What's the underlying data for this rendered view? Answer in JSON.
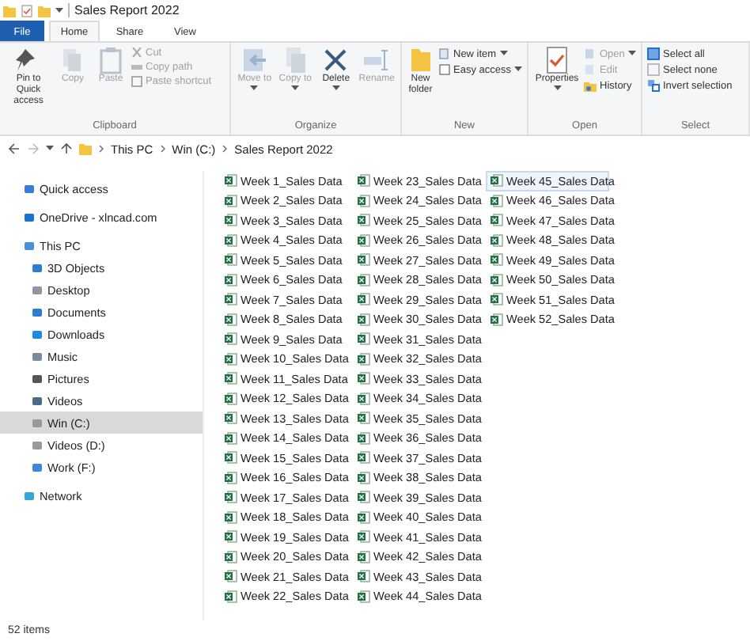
{
  "title_bar": {
    "title": "Sales Report 2022"
  },
  "ribbon_tabs": [
    {
      "label": "File",
      "kind": "file",
      "selected": false
    },
    {
      "label": "Home",
      "kind": "tab",
      "selected": true
    },
    {
      "label": "Share",
      "kind": "tab",
      "selected": false
    },
    {
      "label": "View",
      "kind": "tab",
      "selected": false
    }
  ],
  "ribbon_groups": [
    {
      "label": "Clipboard",
      "buttons": [
        {
          "label": "Pin to Quick access",
          "kind": "large",
          "disabled": false,
          "dropdown": false
        },
        {
          "label": "Copy",
          "kind": "large",
          "disabled": true,
          "dropdown": false
        },
        {
          "label": "Paste",
          "kind": "large",
          "disabled": true,
          "dropdown": false
        },
        {
          "label": "Cut",
          "kind": "small",
          "disabled": true,
          "dropdown": false
        },
        {
          "label": "Copy path",
          "kind": "small",
          "disabled": true,
          "dropdown": false
        },
        {
          "label": "Paste shortcut",
          "kind": "small",
          "disabled": true,
          "dropdown": false
        }
      ]
    },
    {
      "label": "Organize",
      "buttons": [
        {
          "label": "Move to",
          "kind": "large",
          "disabled": true,
          "dropdown": true
        },
        {
          "label": "Copy to",
          "kind": "large",
          "disabled": true,
          "dropdown": true
        },
        {
          "label": "Delete",
          "kind": "large",
          "disabled": false,
          "dropdown": true
        },
        {
          "label": "Rename",
          "kind": "large",
          "disabled": true,
          "dropdown": false
        }
      ]
    },
    {
      "label": "New",
      "buttons": [
        {
          "label": "New folder",
          "kind": "large",
          "disabled": false,
          "dropdown": false
        },
        {
          "label": "New item",
          "kind": "small",
          "disabled": false,
          "dropdown": true
        },
        {
          "label": "Easy access",
          "kind": "small",
          "disabled": false,
          "dropdown": true
        }
      ]
    },
    {
      "label": "Open",
      "buttons": [
        {
          "label": "Properties",
          "kind": "large",
          "disabled": false,
          "dropdown": true
        },
        {
          "label": "Open",
          "kind": "small",
          "disabled": true,
          "dropdown": true
        },
        {
          "label": "Edit",
          "kind": "small",
          "disabled": true,
          "dropdown": false
        },
        {
          "label": "History",
          "kind": "small",
          "disabled": false,
          "dropdown": false
        }
      ]
    },
    {
      "label": "Select",
      "buttons": [
        {
          "label": "Select all",
          "kind": "small",
          "disabled": false,
          "dropdown": false
        },
        {
          "label": "Select none",
          "kind": "small",
          "disabled": false,
          "dropdown": false
        },
        {
          "label": "Invert selection",
          "kind": "small",
          "disabled": false,
          "dropdown": false
        }
      ]
    }
  ],
  "address_bar": {
    "crumbs": [
      "This PC",
      "Win (C:)",
      "Sales Report 2022"
    ]
  },
  "nav_pane": [
    {
      "label": "Quick access",
      "selected": false
    },
    {
      "label": "OneDrive - xlncad.com",
      "selected": false
    },
    {
      "label": "This PC",
      "selected": false,
      "children": [
        {
          "label": "3D Objects",
          "selected": false
        },
        {
          "label": "Desktop",
          "selected": false
        },
        {
          "label": "Documents",
          "selected": false
        },
        {
          "label": "Downloads",
          "selected": false
        },
        {
          "label": "Music",
          "selected": false
        },
        {
          "label": "Pictures",
          "selected": false
        },
        {
          "label": "Videos",
          "selected": false
        },
        {
          "label": "Win (C:)",
          "selected": true
        },
        {
          "label": "Videos (D:)",
          "selected": false
        },
        {
          "label": "Work (F:)",
          "selected": false
        }
      ]
    },
    {
      "label": "Network",
      "selected": false
    }
  ],
  "files": [
    {
      "name": "Week 1_Sales Data",
      "selected": false
    },
    {
      "name": "Week 2_Sales Data",
      "selected": false
    },
    {
      "name": "Week 3_Sales Data",
      "selected": false
    },
    {
      "name": "Week 4_Sales Data",
      "selected": false
    },
    {
      "name": "Week 5_Sales Data",
      "selected": false
    },
    {
      "name": "Week 6_Sales Data",
      "selected": false
    },
    {
      "name": "Week 7_Sales Data",
      "selected": false
    },
    {
      "name": "Week 8_Sales Data",
      "selected": false
    },
    {
      "name": "Week 9_Sales Data",
      "selected": false
    },
    {
      "name": "Week 10_Sales Data",
      "selected": false
    },
    {
      "name": "Week 11_Sales Data",
      "selected": false
    },
    {
      "name": "Week 12_Sales Data",
      "selected": false
    },
    {
      "name": "Week 13_Sales Data",
      "selected": false
    },
    {
      "name": "Week 14_Sales Data",
      "selected": false
    },
    {
      "name": "Week 15_Sales Data",
      "selected": false
    },
    {
      "name": "Week 16_Sales Data",
      "selected": false
    },
    {
      "name": "Week 17_Sales Data",
      "selected": false
    },
    {
      "name": "Week 18_Sales Data",
      "selected": false
    },
    {
      "name": "Week 19_Sales Data",
      "selected": false
    },
    {
      "name": "Week 20_Sales Data",
      "selected": false
    },
    {
      "name": "Week 21_Sales Data",
      "selected": false
    },
    {
      "name": "Week 22_Sales Data",
      "selected": false
    },
    {
      "name": "Week 23_Sales Data",
      "selected": false
    },
    {
      "name": "Week 24_Sales Data",
      "selected": false
    },
    {
      "name": "Week 25_Sales Data",
      "selected": false
    },
    {
      "name": "Week 26_Sales Data",
      "selected": false
    },
    {
      "name": "Week 27_Sales Data",
      "selected": false
    },
    {
      "name": "Week 28_Sales Data",
      "selected": false
    },
    {
      "name": "Week 29_Sales Data",
      "selected": false
    },
    {
      "name": "Week 30_Sales Data",
      "selected": false
    },
    {
      "name": "Week 31_Sales Data",
      "selected": false
    },
    {
      "name": "Week 32_Sales Data",
      "selected": false
    },
    {
      "name": "Week 33_Sales Data",
      "selected": false
    },
    {
      "name": "Week 34_Sales Data",
      "selected": false
    },
    {
      "name": "Week 35_Sales Data",
      "selected": false
    },
    {
      "name": "Week 36_Sales Data",
      "selected": false
    },
    {
      "name": "Week 37_Sales Data",
      "selected": false
    },
    {
      "name": "Week 38_Sales Data",
      "selected": false
    },
    {
      "name": "Week 39_Sales Data",
      "selected": false
    },
    {
      "name": "Week 40_Sales Data",
      "selected": false
    },
    {
      "name": "Week 41_Sales Data",
      "selected": false
    },
    {
      "name": "Week 42_Sales Data",
      "selected": false
    },
    {
      "name": "Week 43_Sales Data",
      "selected": false
    },
    {
      "name": "Week 44_Sales Data",
      "selected": false
    },
    {
      "name": "Week 45_Sales Data",
      "selected": true
    },
    {
      "name": "Week 46_Sales Data",
      "selected": false
    },
    {
      "name": "Week 47_Sales Data",
      "selected": false
    },
    {
      "name": "Week 48_Sales Data",
      "selected": false
    },
    {
      "name": "Week 49_Sales Data",
      "selected": false
    },
    {
      "name": "Week 50_Sales Data",
      "selected": false
    },
    {
      "name": "Week 51_Sales Data",
      "selected": false
    },
    {
      "name": "Week 52_Sales Data",
      "selected": false
    }
  ],
  "status_bar": {
    "count": "52 items"
  }
}
